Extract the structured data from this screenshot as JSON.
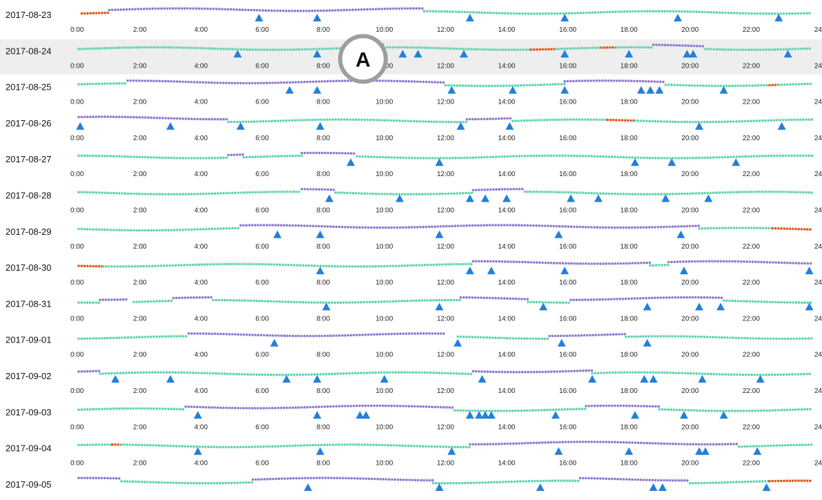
{
  "chart_data": {
    "type": "scatter",
    "x_domain_hours": [
      0,
      24
    ],
    "x_tick_labels": [
      "0:00",
      "2:00",
      "4:00",
      "6:00",
      "8:00",
      "10:00",
      "12:00",
      "14:00",
      "16:00",
      "18:00",
      "20:00",
      "22:00",
      "24"
    ],
    "highlighted_row": "2017-08-24",
    "annotation": {
      "label": "A",
      "date": "2017-08-24",
      "time_hours": 9.3
    },
    "colors": {
      "teal": "#5fd3b0",
      "purple": "#8d79cf",
      "orange": "#e0581c",
      "triangle": "#2380d8",
      "highlight": "#eeeeee",
      "annotation_ring": "#9e9e9e"
    },
    "rows": [
      {
        "date": "2017-08-23",
        "segments": [
          [
            "orange",
            0.1,
            1.0
          ],
          [
            "purple",
            1.0,
            11.3
          ],
          [
            "teal",
            11.3,
            24
          ]
        ],
        "triangles": [
          5.9,
          7.8,
          12.8,
          15.9,
          19.6,
          22.9
        ]
      },
      {
        "date": "2017-08-24",
        "segments": [
          [
            "teal",
            0,
            9.0
          ],
          [
            "purple",
            9.0,
            10.0
          ],
          [
            "teal",
            10.0,
            14.8
          ],
          [
            "orange",
            14.8,
            15.6
          ],
          [
            "teal",
            15.6,
            17.1
          ],
          [
            "orange",
            17.1,
            17.6
          ],
          [
            "teal",
            17.6,
            18.8
          ],
          [
            "purple",
            18.8,
            20.5
          ],
          [
            "teal",
            20.5,
            24
          ]
        ],
        "triangles": [
          5.2,
          7.8,
          10.6,
          11.1,
          12.6,
          15.9,
          18.0,
          19.9,
          20.1,
          23.2
        ]
      },
      {
        "date": "2017-08-25",
        "segments": [
          [
            "teal",
            0,
            1.6
          ],
          [
            "purple",
            1.6,
            12.0
          ],
          [
            "teal",
            12.0,
            15.9
          ],
          [
            "purple",
            15.9,
            19.2
          ],
          [
            "teal",
            19.2,
            22.6
          ],
          [
            "orange",
            22.6,
            22.9
          ],
          [
            "teal",
            22.9,
            24
          ]
        ],
        "triangles": [
          6.9,
          7.8,
          12.2,
          14.2,
          15.9,
          18.4,
          18.7,
          19.0,
          21.1
        ]
      },
      {
        "date": "2017-08-26",
        "segments": [
          [
            "purple",
            0,
            4.9
          ],
          [
            "teal",
            4.9,
            12.7
          ],
          [
            "purple",
            12.7,
            14.2
          ],
          [
            "teal",
            14.2,
            17.3
          ],
          [
            "orange",
            17.3,
            18.2
          ],
          [
            "teal",
            18.2,
            24
          ]
        ],
        "triangles": [
          0.05,
          3.0,
          5.3,
          7.9,
          12.5,
          14.1,
          20.3,
          23.0
        ]
      },
      {
        "date": "2017-08-27",
        "segments": [
          [
            "teal",
            0,
            4.9
          ],
          [
            "purple",
            4.9,
            5.4
          ],
          [
            "teal",
            5.4,
            7.3
          ],
          [
            "purple",
            7.3,
            9.1
          ],
          [
            "teal",
            9.1,
            24
          ]
        ],
        "triangles": [
          8.9,
          11.8,
          18.2,
          19.4,
          21.5
        ]
      },
      {
        "date": "2017-08-28",
        "segments": [
          [
            "teal",
            0,
            7.3
          ],
          [
            "purple",
            7.3,
            8.4
          ],
          [
            "teal",
            8.4,
            12.9
          ],
          [
            "purple",
            12.9,
            14.6
          ],
          [
            "teal",
            14.6,
            24
          ]
        ],
        "triangles": [
          8.2,
          10.5,
          12.8,
          13.3,
          14.0,
          16.1,
          17.0,
          19.2,
          20.6
        ]
      },
      {
        "date": "2017-08-29",
        "segments": [
          [
            "teal",
            0,
            5.3
          ],
          [
            "purple",
            5.3,
            20.3
          ],
          [
            "teal",
            20.3,
            22.7
          ],
          [
            "orange",
            22.7,
            24
          ]
        ],
        "triangles": [
          6.5,
          7.9,
          11.8,
          15.7,
          19.7
        ]
      },
      {
        "date": "2017-08-30",
        "segments": [
          [
            "orange",
            0,
            0.8
          ],
          [
            "teal",
            0.8,
            12.9
          ],
          [
            "purple",
            12.9,
            18.7
          ],
          [
            "teal",
            18.7,
            19.3
          ],
          [
            "purple",
            19.3,
            24
          ]
        ],
        "triangles": [
          7.9,
          12.8,
          13.5,
          15.9,
          19.8,
          23.9
        ]
      },
      {
        "date": "2017-08-31",
        "segments": [
          [
            "teal",
            0,
            0.7
          ],
          [
            "purple",
            0.7,
            1.6
          ],
          [
            "teal",
            1.8,
            3.1
          ],
          [
            "purple",
            3.1,
            4.4
          ],
          [
            "teal",
            4.4,
            12.5
          ],
          [
            "purple",
            12.5,
            14.7
          ],
          [
            "teal",
            14.7,
            16.1
          ],
          [
            "purple",
            16.1,
            21.1
          ],
          [
            "teal",
            21.1,
            24
          ]
        ],
        "triangles": [
          8.1,
          11.8,
          15.2,
          18.6,
          20.3,
          21.0,
          23.9
        ]
      },
      {
        "date": "2017-09-01",
        "segments": [
          [
            "teal",
            0,
            3.6
          ],
          [
            "purple",
            3.6,
            12.0
          ],
          [
            "teal",
            12.4,
            15.4
          ],
          [
            "purple",
            15.4,
            17.9
          ],
          [
            "teal",
            17.9,
            24
          ]
        ],
        "triangles": [
          6.4,
          12.4,
          15.8,
          18.6
        ]
      },
      {
        "date": "2017-09-02",
        "segments": [
          [
            "purple",
            0,
            0.7
          ],
          [
            "teal",
            0.7,
            12.9
          ],
          [
            "purple",
            12.9,
            16.8
          ],
          [
            "teal",
            16.8,
            24
          ]
        ],
        "triangles": [
          1.2,
          3.0,
          6.8,
          7.8,
          10.0,
          13.2,
          16.8,
          18.5,
          18.8,
          20.4,
          22.3
        ]
      },
      {
        "date": "2017-09-03",
        "segments": [
          [
            "teal",
            0,
            3.5
          ],
          [
            "purple",
            3.5,
            12.3
          ],
          [
            "teal",
            12.3,
            16.6
          ],
          [
            "purple",
            16.6,
            19.0
          ],
          [
            "teal",
            19.0,
            24
          ]
        ],
        "triangles": [
          3.9,
          7.8,
          9.2,
          9.4,
          12.8,
          13.1,
          13.3,
          13.5,
          15.6,
          18.2,
          19.8,
          21.1
        ]
      },
      {
        "date": "2017-09-04",
        "segments": [
          [
            "teal",
            0,
            1.1
          ],
          [
            "orange",
            1.1,
            1.4
          ],
          [
            "teal",
            1.4,
            12.8
          ],
          [
            "purple",
            12.8,
            21.6
          ],
          [
            "teal",
            21.6,
            24
          ]
        ],
        "triangles": [
          3.9,
          7.9,
          12.2,
          15.7,
          18.0,
          20.3,
          20.5,
          22.2
        ]
      },
      {
        "date": "2017-09-05",
        "segments": [
          [
            "purple",
            0,
            1.4
          ],
          [
            "teal",
            1.4,
            5.7
          ],
          [
            "purple",
            5.7,
            11.6
          ],
          [
            "teal",
            11.6,
            16.4
          ],
          [
            "purple",
            16.4,
            20.0
          ],
          [
            "teal",
            20.0,
            22.6
          ],
          [
            "orange",
            22.6,
            24
          ]
        ],
        "triangles": [
          7.5,
          11.8,
          15.1,
          18.8,
          19.1,
          22.5
        ]
      }
    ]
  }
}
